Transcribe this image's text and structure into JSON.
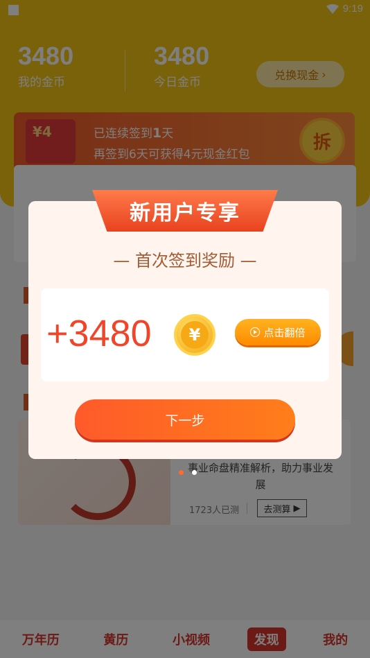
{
  "status_bar": {
    "time": "9:19"
  },
  "header": {
    "my_coins_value": "3480",
    "my_coins_label": "我的金币",
    "today_coins_value": "3480",
    "today_coins_label": "今日金币",
    "exchange_label": "兑换现金"
  },
  "checkin": {
    "envelope_amount": "¥4",
    "line1_prefix": "已连续签到",
    "line1_days": "1",
    "line1_suffix": "天",
    "line2": "再签到6天可获得4元现金红包",
    "open_label": "拆"
  },
  "career": {
    "desc": "事业命盘精准解析，助力事业发展",
    "count": "1723人已测",
    "button": "去测算"
  },
  "modal": {
    "ribbon": "新用户专享",
    "subtitle": "— 首次签到奖励 —",
    "amount": "+3480",
    "coin_symbol": "¥",
    "double_label": "点击翻倍",
    "next_label": "下一步"
  },
  "bottom_nav": {
    "items": [
      "万年历",
      "黄历",
      "小视频",
      "发现",
      "我的"
    ],
    "active": "发现"
  },
  "colors": {
    "accent_yellow": "#f3c514",
    "accent_orange": "#ff6a2e",
    "accent_red": "#f1452a"
  }
}
